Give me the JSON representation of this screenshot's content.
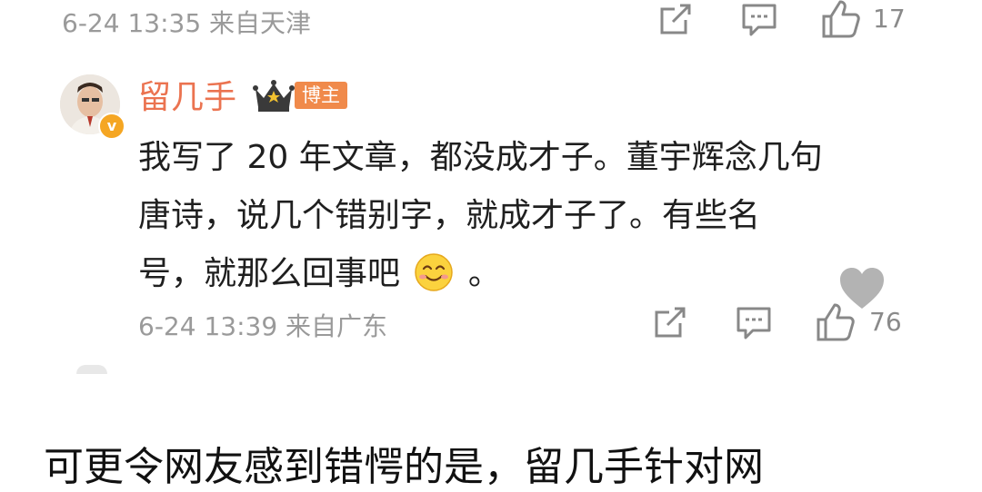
{
  "comment_prev": {
    "meta": "6-24 13:35 来自天津",
    "like_count": "17"
  },
  "comment": {
    "username": "留几手",
    "level_tag": "博主",
    "content_lines": [
      "我写了 20 年文章，都没成才子。董宇辉念几句",
      "唐诗，说几个错别字，就成才子了。有些名",
      "号，就那么回事吧"
    ],
    "content_end": "。",
    "meta": "6-24 13:39 来自广东",
    "like_count": "76"
  },
  "article_text": "可更令网友感到错愕的是，留几手针对网",
  "icons": [
    "repost-icon",
    "comment-icon",
    "like-icon",
    "crown-icon",
    "verified-icon",
    "smile-emoji-icon",
    "heart-icon"
  ],
  "colors": {
    "username": "#eb7350",
    "badge": "#f08a4b",
    "meta": "#9a9a9a",
    "text": "#1f1f1f"
  }
}
